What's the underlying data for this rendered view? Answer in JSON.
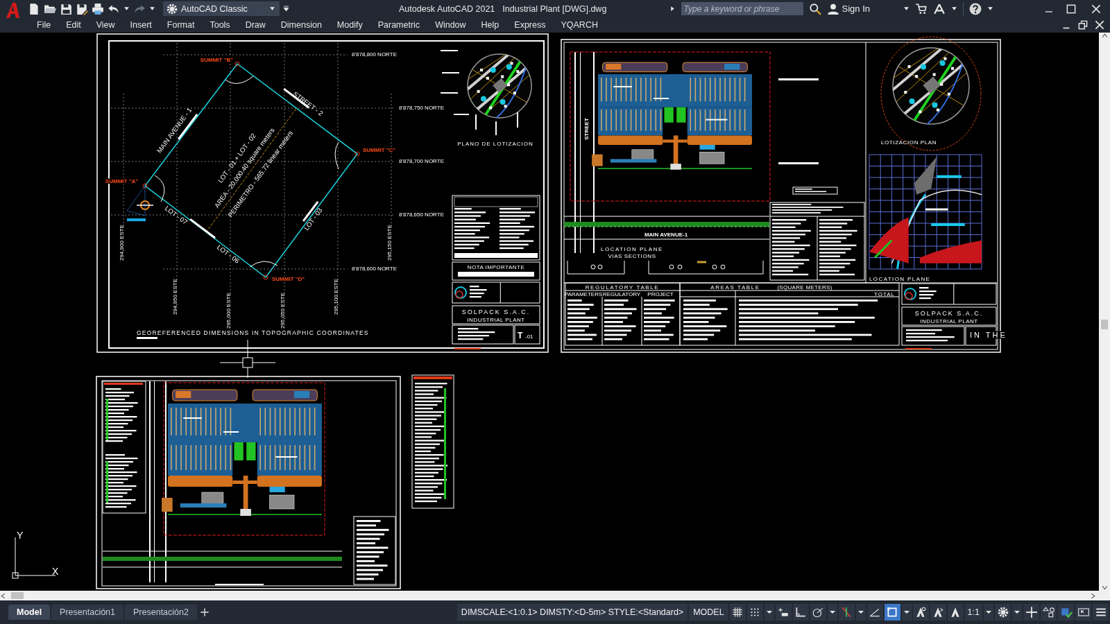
{
  "title_bar": {
    "workspace": "AutoCAD Classic",
    "app_title": "Autodesk AutoCAD 2021",
    "file_title": "Industrial Plant [DWG].dwg",
    "search": {
      "placeholder": "Type a keyword or phrase"
    },
    "sign_in": "Sign In"
  },
  "menu_bar": [
    "File",
    "Edit",
    "View",
    "Insert",
    "Format",
    "Tools",
    "Draw",
    "Dimension",
    "Modify",
    "Parametric",
    "Window",
    "Help",
    "Express",
    "YQARCH"
  ],
  "drawing": {
    "sheet_1": {
      "north_labels": [
        "8'878,800 NORTE",
        "8'878,750 NORTE",
        "8'878,700 NORTE",
        "8'878,650 NORTE",
        "8'878,600 NORTE"
      ],
      "east_labels": [
        "294,900 ESTE",
        "294,950 ESTE",
        "295,000 ESTE",
        "295,050 ESTE",
        "295,100 ESTE",
        "295,150 ESTE"
      ],
      "summits": [
        "SUMMIT \"A\"",
        "SUMMIT \"B\"",
        "SUMMIT \"C\"",
        "SUMMIT \"D\""
      ],
      "edge_labels": [
        "MAIN AVENUE - 1",
        "STREET - 2",
        "LOT - 03",
        "LOT - 06",
        "LOT - 07"
      ],
      "lot_summary": [
        "LOT - 01 + LOT - 02",
        "AREA - 20,000.40 square meters",
        "PERIMETRO - 565.72 linear meters"
      ],
      "key_map_title": "PLANO DE LOTIZACION",
      "note_title": "NOTA IMPORTANTE",
      "company": "SOLPACK S.A.C.",
      "project": "INDUSTRIAL PLANT",
      "sheet_number": "T",
      "sheet_suffix": "-01",
      "caption": "GEOREFERENCED DIMENSIONS IN TOPOGRAPHIC COORDINATES"
    },
    "sheet_2": {
      "street_label": "STREET",
      "avenue_label": "MAIN AVENUE-1",
      "location_title": "LOCATION PLANE",
      "sections_title": "VIAS SECTIONS",
      "key_map_title": "LOTIZACION PLAN",
      "location_map_title": "LOCATION PLANE",
      "regulatory_table": {
        "title": "REGULATORY TABLE",
        "columns": [
          "PARAMETERS",
          "REGULATORY",
          "PROJECT"
        ]
      },
      "areas_table": {
        "title": "AREAS TABLE",
        "unit": "(SQUARE METERS)",
        "total": "TOTAL"
      },
      "company": "SOLPACK S.A.C.",
      "project": "INDUSTRIAL PLANT",
      "overlay_text": "IN THE"
    },
    "ucs": {
      "y_label": "Y",
      "x_label": "X"
    }
  },
  "layout_tabs": [
    {
      "label": "Model",
      "selected": true
    },
    {
      "label": "Presentación1",
      "selected": false
    },
    {
      "label": "Presentación2",
      "selected": false
    }
  ],
  "status_bar": {
    "variables": "DIMSCALE:<1:0.1> DIMSTY:<D-5m> STYLE:<Standard>",
    "space": "MODEL",
    "tools": [
      {
        "kind": "grid",
        "on": false
      },
      {
        "kind": "snap",
        "on": false
      },
      {
        "kind": "caret"
      },
      {
        "kind": "dynamic-input",
        "on": false
      },
      {
        "kind": "ortho",
        "on": false
      },
      {
        "kind": "polar",
        "on": false
      },
      {
        "kind": "caret"
      },
      {
        "kind": "osnap",
        "on": false
      },
      {
        "kind": "caret"
      },
      {
        "kind": "angle",
        "on": false
      },
      {
        "kind": "selection",
        "on": true
      },
      {
        "kind": "caret"
      },
      {
        "kind": "annotation",
        "on": false
      },
      {
        "kind": "autoscale",
        "on": false
      },
      {
        "kind": "annoscale",
        "on": false
      },
      {
        "kind": "scale",
        "label": "1:1"
      },
      {
        "kind": "caret"
      },
      {
        "kind": "gear",
        "on": false
      },
      {
        "kind": "caret"
      },
      {
        "kind": "plus",
        "on": false
      },
      {
        "kind": "isolate",
        "on": false
      },
      {
        "kind": "hardware",
        "on": false
      },
      {
        "kind": "fullscreen",
        "on": false
      },
      {
        "kind": "menu",
        "on": false
      }
    ]
  }
}
